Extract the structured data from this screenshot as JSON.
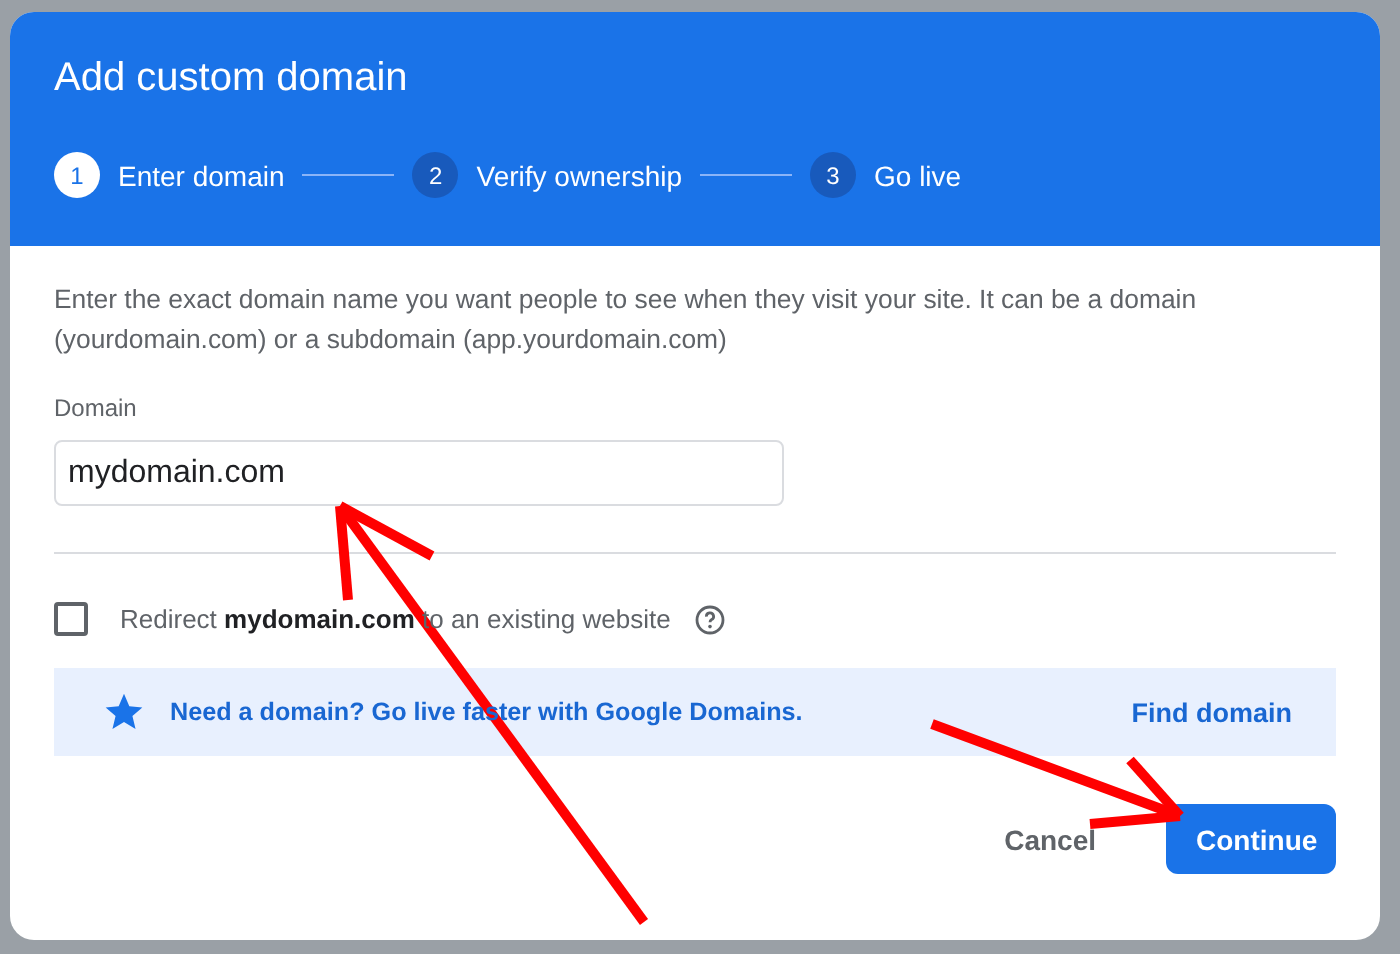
{
  "dialog": {
    "title": "Add custom domain"
  },
  "steps": [
    {
      "number": "1",
      "label": "Enter domain",
      "selected": true
    },
    {
      "number": "2",
      "label": "Verify ownership",
      "selected": false
    },
    {
      "number": "3",
      "label": "Go live",
      "selected": false
    }
  ],
  "description": "Enter the exact domain name you want people to see when they visit your site. It can be a domain (yourdomain.com) or a subdomain (app.yourdomain.com)",
  "domain_field": {
    "label": "Domain",
    "value": "mydomain.com"
  },
  "redirect": {
    "label": "Redirect **mydomain.com** to an existing website",
    "checked": false
  },
  "promo": {
    "text": "Need a domain? Go live faster with Google Domains.",
    "link": "Find domain"
  },
  "buttons": [
    {
      "label": "Cancel",
      "kind": "text"
    },
    {
      "label": "Continue",
      "kind": "primary"
    }
  ]
}
